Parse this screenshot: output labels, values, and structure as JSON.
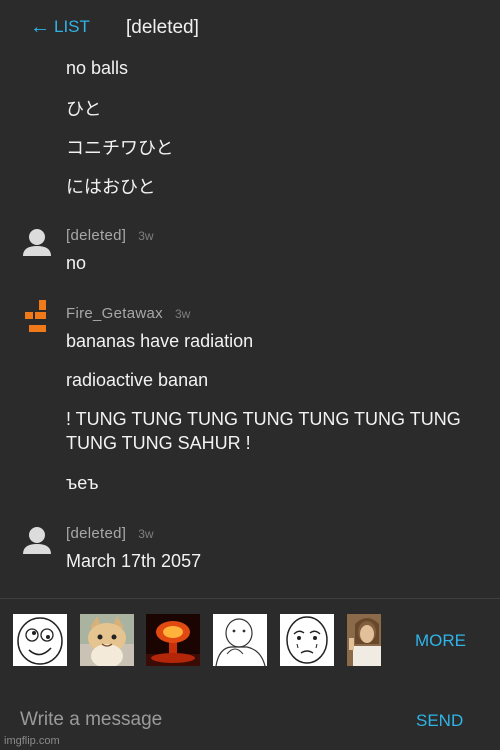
{
  "header": {
    "back_label": "LIST",
    "title": "[deleted]"
  },
  "feed": {
    "earlier_lines": [
      "no balls",
      "ひと",
      "コニチワひと",
      "にはおひと"
    ],
    "comment_1": {
      "username": "[deleted]",
      "time": "3w",
      "lines": [
        "no"
      ]
    },
    "comment_2": {
      "username": "Fire_Getawax",
      "time": "3w",
      "lines": [
        "bananas have radiation",
        "radioactive banan",
        "! TUNG TUNG TUNG TUNG TUNG TUNG TUNG TUNG TUNG SAHUR !",
        "ъеъ"
      ]
    },
    "comment_3": {
      "username": "[deleted]",
      "time": "3w",
      "lines": [
        "March 17th 2057"
      ]
    }
  },
  "meme_bar": {
    "memes": [
      "derp-face-meme",
      "cat-meme",
      "explosion-meme",
      "sketch-meme",
      "okay-face-meme",
      "jesus-meme"
    ],
    "more_label": "MORE"
  },
  "compose": {
    "placeholder": "Write a message",
    "send_label": "SEND"
  },
  "watermark": "imgflip.com",
  "colors": {
    "accent": "#2fb4e8",
    "background": "#2b2b2b",
    "avatar_orange": "#f07a1a"
  }
}
